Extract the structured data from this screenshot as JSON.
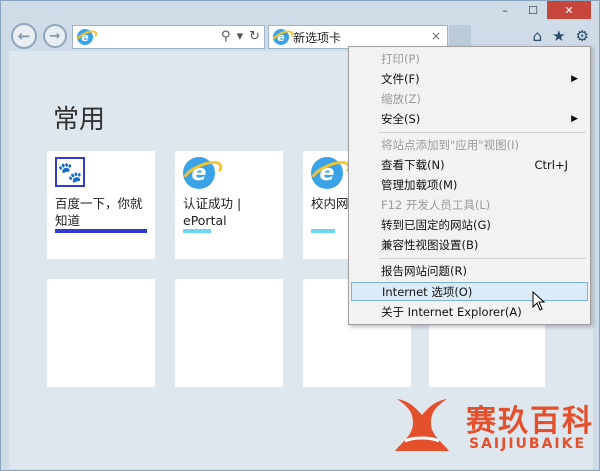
{
  "window": {
    "caption": {
      "minimize": "–",
      "maximize": "☐",
      "close": "✕"
    }
  },
  "nav": {
    "back": "←",
    "forward": "→",
    "address_value": "",
    "tab_title": "新选项卡",
    "tab_close": "×",
    "right_icons": [
      "home-icon",
      "favorites-star-icon",
      "gear-icon"
    ]
  },
  "newtab": {
    "heading": "常用",
    "tiles": [
      {
        "label": "百度一下，你就知道",
        "icon": "baidu-paw-icon",
        "bar_color": "#2f3bd1",
        "bar_fill": 1.0
      },
      {
        "label": "认证成功 | ePortal",
        "icon": "ie-icon",
        "bar_color": "#6fd6f2",
        "bar_fill": 0.3
      },
      {
        "label": "校内网 - 校内网",
        "icon": "ie-icon",
        "bar_color": "#6fd6f2",
        "bar_fill": 0.25
      }
    ]
  },
  "menu": {
    "items": [
      {
        "label": "打印(P)",
        "disabled": true,
        "submenu": false,
        "shortcut": ""
      },
      {
        "label": "文件(F)",
        "disabled": false,
        "submenu": true,
        "shortcut": ""
      },
      {
        "label": "缩放(Z)",
        "disabled": true,
        "submenu": false,
        "shortcut": ""
      },
      {
        "label": "安全(S)",
        "disabled": false,
        "submenu": true,
        "shortcut": ""
      },
      {
        "label": "将站点添加到\"应用\"视图(I)",
        "disabled": true,
        "submenu": false,
        "shortcut": ""
      },
      {
        "label": "查看下载(N)",
        "disabled": false,
        "submenu": false,
        "shortcut": "Ctrl+J"
      },
      {
        "label": "管理加载项(M)",
        "disabled": false,
        "submenu": false,
        "shortcut": ""
      },
      {
        "label": "F12 开发人员工具(L)",
        "disabled": true,
        "submenu": false,
        "shortcut": ""
      },
      {
        "label": "转到已固定的网站(G)",
        "disabled": false,
        "submenu": false,
        "shortcut": ""
      },
      {
        "label": "兼容性视图设置(B)",
        "disabled": false,
        "submenu": false,
        "shortcut": ""
      },
      {
        "label": "报告网站问题(R)",
        "disabled": false,
        "submenu": false,
        "shortcut": ""
      },
      {
        "label": "Internet 选项(O)",
        "disabled": false,
        "submenu": false,
        "shortcut": "",
        "highlighted": true
      },
      {
        "label": "关于 Internet Explorer(A)",
        "disabled": false,
        "submenu": false,
        "shortcut": ""
      }
    ]
  },
  "watermark": {
    "title": "赛玖百科",
    "subtitle": "SAIJIUBAIKE",
    "color": "#e5502c"
  }
}
